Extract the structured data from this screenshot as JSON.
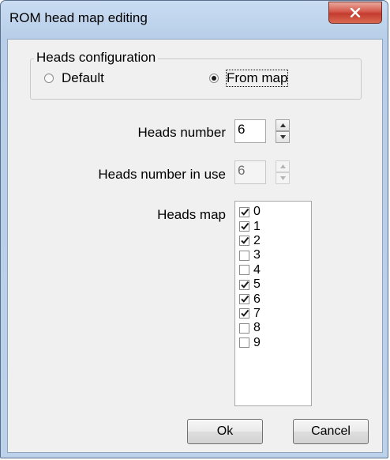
{
  "window": {
    "title": "ROM head map editing"
  },
  "heads_configuration": {
    "group_title": "Heads configuration",
    "options": [
      {
        "label": "Default",
        "selected": false
      },
      {
        "label": "From map",
        "selected": true
      }
    ]
  },
  "heads_number": {
    "label": "Heads number",
    "value": "6"
  },
  "heads_number_in_use": {
    "label": "Heads number in use",
    "value": "6",
    "enabled": false
  },
  "heads_map": {
    "label": "Heads map",
    "items": [
      {
        "label": "0",
        "checked": true
      },
      {
        "label": "1",
        "checked": true
      },
      {
        "label": "2",
        "checked": true
      },
      {
        "label": "3",
        "checked": false
      },
      {
        "label": "4",
        "checked": false
      },
      {
        "label": "5",
        "checked": true
      },
      {
        "label": "6",
        "checked": true
      },
      {
        "label": "7",
        "checked": true
      },
      {
        "label": "8",
        "checked": false
      },
      {
        "label": "9",
        "checked": false
      }
    ]
  },
  "buttons": {
    "ok": "Ok",
    "cancel": "Cancel"
  }
}
